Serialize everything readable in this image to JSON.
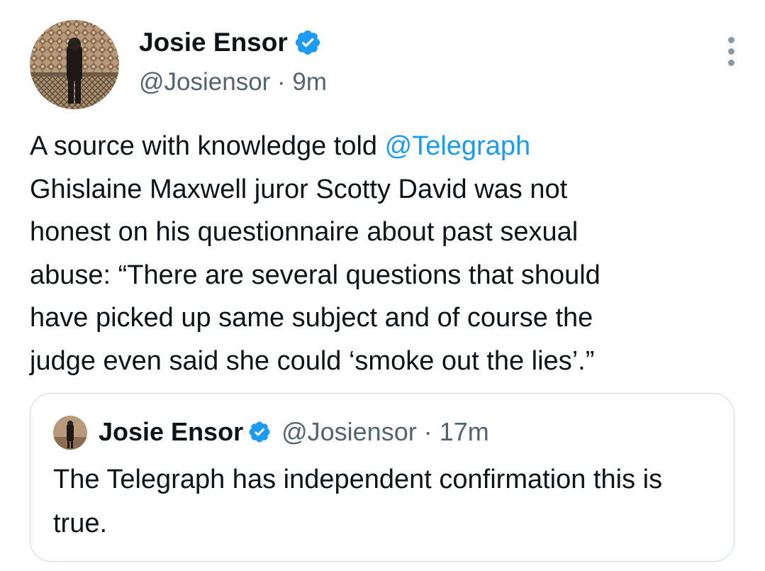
{
  "author": {
    "name": "Josie Ensor",
    "handle_time": "@Josiensor · 9m"
  },
  "tweet": {
    "text_before": "A source with knowledge told ",
    "mention": "@Telegraph",
    "text_after": "\nGhislaine Maxwell juror Scotty David was not\nhonest on his questionnaire about past sexual\nabuse: “There are several questions that should\nhave picked up same subject and of course the\njudge even said she could ‘smoke out the lies’.”"
  },
  "quoted_tweet": {
    "name": "Josie Ensor",
    "handle_time": "@Josiensor · 17m",
    "text": "The Telegraph has independent confirmation this is true."
  },
  "colors": {
    "accent": "#1d9bf0",
    "secondary_text": "#536471",
    "border": "#cfd9de"
  },
  "icons": [
    "verified-badge-icon",
    "more-options-icon"
  ]
}
